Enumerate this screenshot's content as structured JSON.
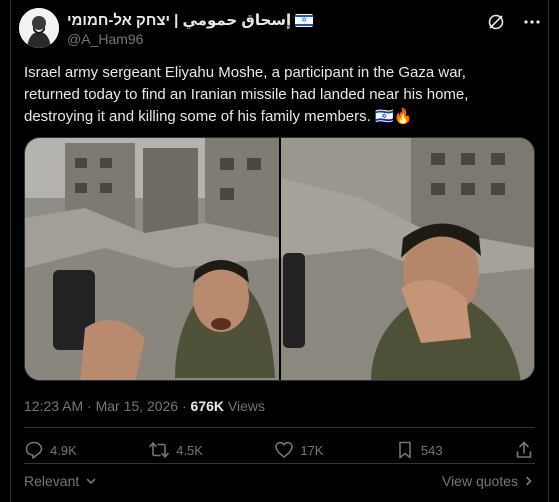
{
  "author": {
    "display_name": "إسحاق حمومي | יצחק אל-חמומי",
    "handle": "@A_Ham96"
  },
  "tweet": {
    "text": "Israel army sergeant Eliyahu Moshe, a participant in the Gaza war, returned today to find an Iranian missile had landed near his home, destroying it and killing some of his family members. 🇮🇱🔥"
  },
  "meta": {
    "timestamp": "12:23 AM · Mar 15, 2026 · ",
    "views_count": "676K",
    "views_label": " Views"
  },
  "actions": {
    "replies": "4.9K",
    "reposts": "4.5K",
    "likes": "17K",
    "bookmarks": "543"
  },
  "footer": {
    "relevant": "Relevant",
    "view_quotes": "View quotes"
  },
  "colors": {
    "background": "#000000",
    "text": "#e7e9ea",
    "muted": "#71767b",
    "border": "#2f3336",
    "flag_blue": "#1f4fd1"
  }
}
